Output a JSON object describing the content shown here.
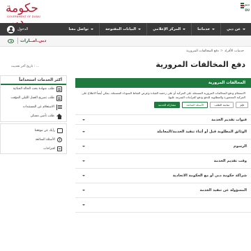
{
  "header": {
    "logo_calligraphy": "حكومة دبي",
    "logo_subtitle": "GOVERNMENT OF DUBAI",
    "dubai_ar": "دبي",
    "dubai_en": "DU"
  },
  "nav": {
    "login": "الدخول",
    "items": [
      "عن دبي",
      "خدماتنا",
      "المركز الإعلامي",
      "البيانات المفتوحة",
      "تواصل معنا"
    ],
    "colors": {
      "bar": "#3a3a3a",
      "accent": "#1f7a3f"
    }
  },
  "subbar": {
    "brand": "دبي.امـ",
    "brand_accent": "ـارات"
  },
  "page": {
    "breadcrumb": [
      "خدمات الأفراد",
      "دفع المخالفات المرورية"
    ],
    "title": "دفع المخالفات المرورية",
    "last_updated": "تاريخ آخر تحديث : ..."
  },
  "sidebar": {
    "most_used_title": "أكثر الخدمات استخداماً",
    "most_used": [
      {
        "label": "طلب شهادة بحث الحالة الجنائية",
        "icon": "document-icon"
      },
      {
        "label": "طلب تصريح العمل الليلي المؤقت",
        "icon": "document-icon"
      },
      {
        "label": "الاستعلام عن المستندات",
        "icon": "list-icon"
      },
      {
        "label": "طلب تأمين مسكن",
        "icon": "house-icon"
      }
    ],
    "links": [
      {
        "label": "رأيك عن موقعنا",
        "icon": "share-icon"
      },
      {
        "label": "الأسئلة الشائعة",
        "icon": "help-icon"
      },
      {
        "label": "اقتراحات",
        "icon": "suggestion-icon"
      }
    ]
  },
  "main": {
    "section_title": "المخالفات المرورية",
    "description": "الاستعلام ودفع المخالفات المرورية المسجلة على المركبة أو على رخصة القيادة وعرض النقاط السوداء المسجلة. يمكن أيضاً الاطلاع على المركبة المحجوزة والمطلوبة للدفع ودفع الغرامات المترتبة عليها.",
    "buttons": [
      {
        "label": "مشاركة الخدمة",
        "style": "fill"
      },
      {
        "label": "الأسئلة الشائعة",
        "style": "outline"
      },
      {
        "label": "متابعة الطلب",
        "style": "grey"
      },
      {
        "label": "قيّم",
        "style": "grey"
      }
    ],
    "accordion": [
      "قنوات تقديم الخدمة",
      "الوثائق المطلوبة قبل أو أثناء تنفيذ الخدمة/المعاملة",
      "الرسوم",
      "وقت تقديم الخدمة",
      "شراكة حكومة دبي أو مع الحكومة الاتحادية",
      "المسؤولة عن تنفيذ الخدمة",
      ""
    ]
  }
}
